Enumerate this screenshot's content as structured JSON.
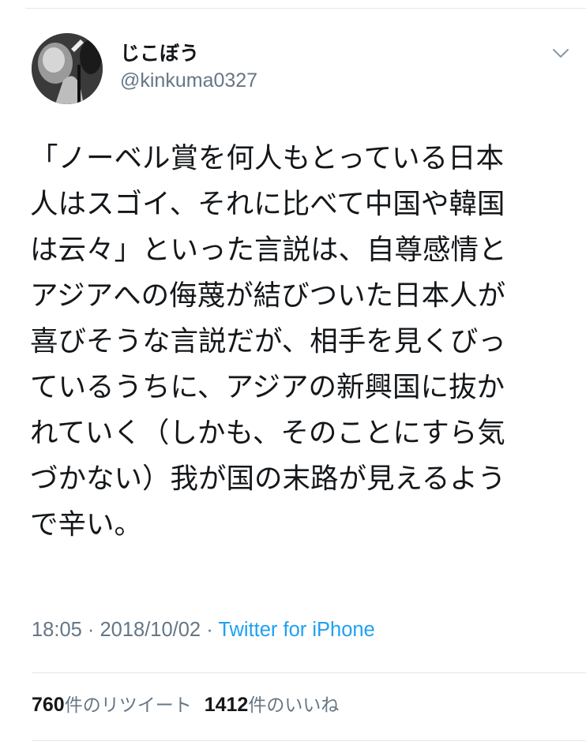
{
  "user": {
    "display_name": "じこぼう",
    "handle": "@kinkuma0327"
  },
  "icons": {
    "menu": "chevron-down-icon",
    "avatar": "avatar-photo"
  },
  "tweet": {
    "lines": [
      "「ノーベル賞を何人もとっている日本",
      "人はスゴイ、それに比べて中国や韓国",
      "は云々」といった言説は、自尊感情と",
      "アジアへの侮蔑が結びついた日本人が",
      "喜びそうな言説だが、相手を見くびっ",
      "ているうちに、アジアの新興国に抜か",
      "れていく（しかも、そのことにすら気",
      "づかない）我が国の末路が見えるよう",
      "で辛い。"
    ]
  },
  "meta": {
    "time": "18:05",
    "sep1": " · ",
    "date": "2018/10/02",
    "sep2": " · ",
    "source": "Twitter for iPhone"
  },
  "stats": {
    "retweets_count": "760",
    "retweets_label": "件のリツイート",
    "likes_count": "1412",
    "likes_label": "件のいいね"
  },
  "colors": {
    "text": "#14171a",
    "secondary": "#657786",
    "link": "#1da1f2",
    "divider": "#e1e8ed"
  }
}
